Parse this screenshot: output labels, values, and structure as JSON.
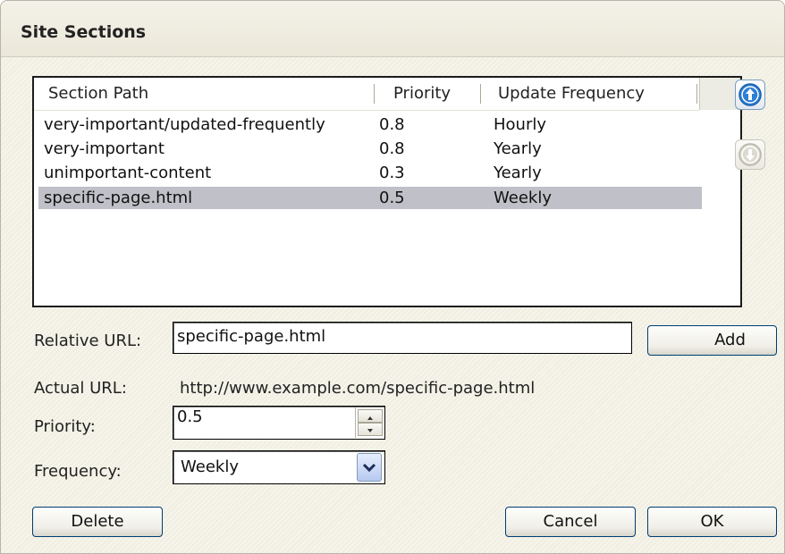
{
  "dialog": {
    "title": "Site Sections"
  },
  "table": {
    "headers": [
      "Section Path",
      "Priority",
      "Update Frequency"
    ],
    "rows": [
      {
        "path": "very-important/updated-frequently",
        "priority": "0.8",
        "frequency": "Hourly"
      },
      {
        "path": "very-important",
        "priority": "0.8",
        "frequency": "Yearly"
      },
      {
        "path": "unimportant-content",
        "priority": "0.3",
        "frequency": "Yearly"
      },
      {
        "path": "specific-page.html",
        "priority": "0.5",
        "frequency": "Weekly",
        "selected": true
      }
    ]
  },
  "side_buttons": {
    "up_icon": "arrow-up-icon",
    "down_icon": "arrow-down-icon",
    "down_enabled": false
  },
  "form": {
    "relative_url_label": "Relative URL:",
    "relative_url_value": "specific-page.html",
    "add_label": "Add",
    "actual_url_label": "Actual URL:",
    "actual_url_value": "http://www.example.com/specific-page.html",
    "priority_label": "Priority:",
    "priority_value": "0.5",
    "frequency_label": "Frequency:",
    "frequency_value": "Weekly"
  },
  "footer": {
    "delete_label": "Delete",
    "cancel_label": "Cancel",
    "ok_label": "OK"
  },
  "colors": {
    "selection": "#c0c0c8",
    "button_border": "#003c74",
    "dialog_bg": "#f1efe2",
    "arrow_blue": "#2d7fd6"
  }
}
